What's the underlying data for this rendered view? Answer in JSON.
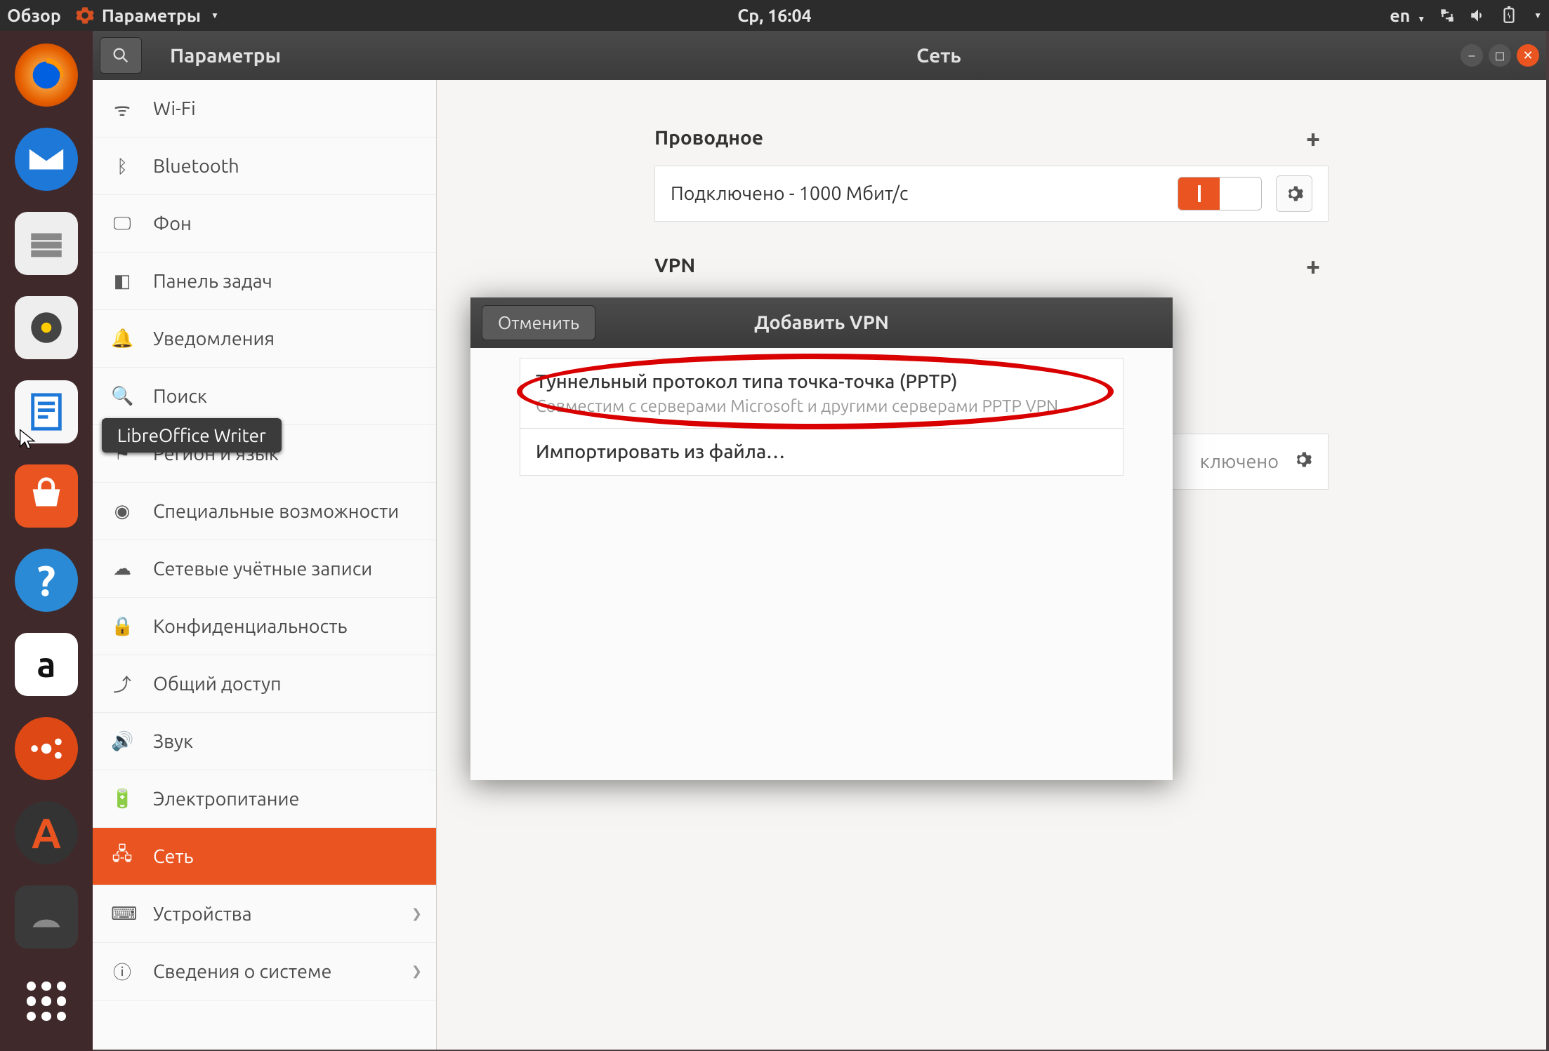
{
  "menubar": {
    "overview": "Обзор",
    "app_name": "Параметры",
    "clock": "Ср, 16:04",
    "lang": "en"
  },
  "launcher": {
    "tooltip": "LibreOffice Writer"
  },
  "window": {
    "sidebar_title": "Параметры",
    "main_title": "Сеть",
    "sidebar_items": [
      {
        "icon": "wifi",
        "label": "Wi-Fi"
      },
      {
        "icon": "bluetooth",
        "label": "Bluetooth"
      },
      {
        "icon": "background",
        "label": "Фон"
      },
      {
        "icon": "dock",
        "label": "Панель задач"
      },
      {
        "icon": "bell",
        "label": "Уведомления"
      },
      {
        "icon": "search",
        "label": "Поиск"
      },
      {
        "icon": "region",
        "label": "Регион и язык"
      },
      {
        "icon": "accessibility",
        "label": "Специальные возможности"
      },
      {
        "icon": "accounts",
        "label": "Сетевые учётные записи"
      },
      {
        "icon": "privacy",
        "label": "Конфиденциальность"
      },
      {
        "icon": "share",
        "label": "Общий доступ"
      },
      {
        "icon": "sound",
        "label": "Звук"
      },
      {
        "icon": "power",
        "label": "Электропитание"
      },
      {
        "icon": "network",
        "label": "Сеть"
      },
      {
        "icon": "devices",
        "label": "Устройства",
        "chevron": true
      },
      {
        "icon": "info",
        "label": "Сведения о системе",
        "chevron": true
      }
    ],
    "selected_index": 13
  },
  "network": {
    "wired_header": "Проводное",
    "wired_status": "Подключено - 1000 Мбит/с",
    "toggle_text": "|",
    "vpn_header": "VPN",
    "vpn_status": "ключено"
  },
  "dialog": {
    "title": "Добавить VPN",
    "cancel": "Отменить",
    "options": [
      {
        "title": "Туннельный протокол типа точка-точка (PPTP)",
        "sub": "Совместим с серверами Microsoft и другими серверами PPTP VPN"
      },
      {
        "title": "Импортировать из файла…",
        "sub": ""
      }
    ]
  }
}
